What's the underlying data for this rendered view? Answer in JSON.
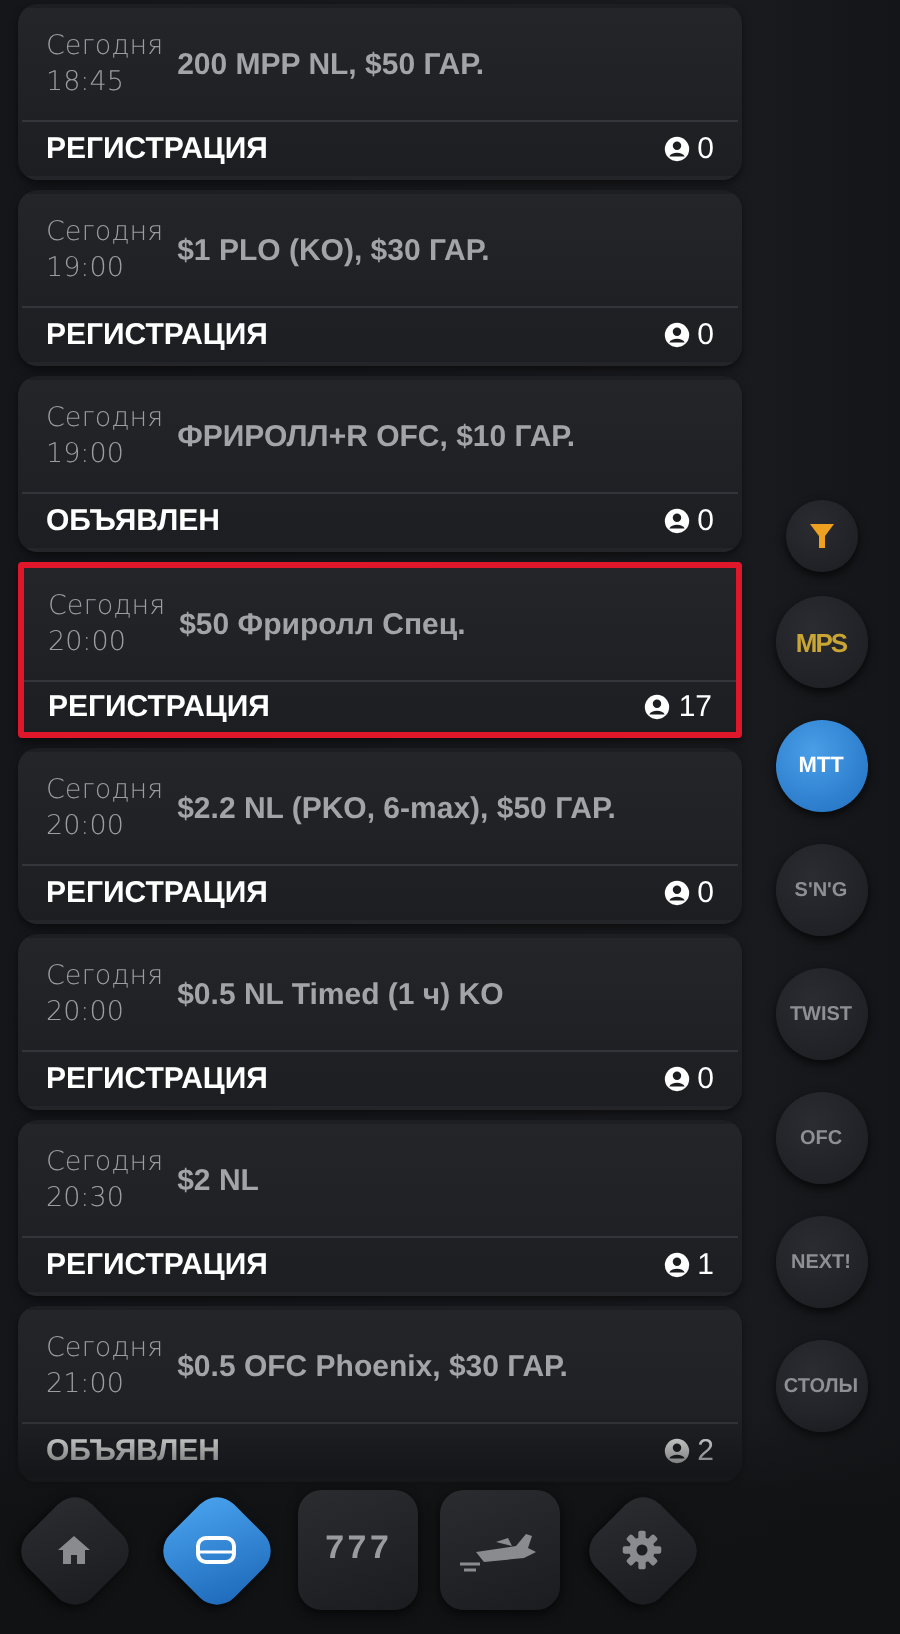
{
  "tournaments": [
    {
      "day": "Сегодня",
      "time": "18:45",
      "title": "200 MPP NL, $50 ГАР.",
      "status": "РЕГИСТРАЦИЯ",
      "players": "0",
      "highlighted": false
    },
    {
      "day": "Сегодня",
      "time": "19:00",
      "title": "$1 PLO (KO), $30 ГАР.",
      "status": "РЕГИСТРАЦИЯ",
      "players": "0",
      "highlighted": false
    },
    {
      "day": "Сегодня",
      "time": "19:00",
      "title": "ФРИРОЛЛ+R OFC, $10 ГАР.",
      "status": "ОБЪЯВЛЕН",
      "players": "0",
      "highlighted": false
    },
    {
      "day": "Сегодня",
      "time": "20:00",
      "title": "$50 Фриролл Спец.",
      "status": "РЕГИСТРАЦИЯ",
      "players": "17",
      "highlighted": true
    },
    {
      "day": "Сегодня",
      "time": "20:00",
      "title": "$2.2 NL (PKO, 6-max), $50 ГАР.",
      "status": "РЕГИСТРАЦИЯ",
      "players": "0",
      "highlighted": false
    },
    {
      "day": "Сегодня",
      "time": "20:00",
      "title": "$0.5 NL Timed (1 ч) KO",
      "status": "РЕГИСТРАЦИЯ",
      "players": "0",
      "highlighted": false
    },
    {
      "day": "Сегодня",
      "time": "20:30",
      "title": "$2 NL",
      "status": "РЕГИСТРАЦИЯ",
      "players": "1",
      "highlighted": false
    },
    {
      "day": "Сегодня",
      "time": "21:00",
      "title": "$0.5 OFC Phoenix, $30 ГАР.",
      "status": "ОБЪЯВЛЕН",
      "players": "2",
      "highlighted": false
    }
  ],
  "rail": [
    {
      "kind": "filter",
      "selected": false
    },
    {
      "kind": "logo",
      "label": "MPS",
      "selected": false
    },
    {
      "kind": "text",
      "label": "MTT",
      "selected": true
    },
    {
      "kind": "text",
      "label": "S'N'G",
      "selected": false
    },
    {
      "kind": "text",
      "label": "TWIST",
      "selected": false
    },
    {
      "kind": "text",
      "label": "OFC",
      "selected": false
    },
    {
      "kind": "text",
      "label": "NEXT!",
      "selected": false
    },
    {
      "kind": "text",
      "label": "СТОЛЫ",
      "selected": false
    }
  ],
  "nav": [
    {
      "kind": "home",
      "selected": false
    },
    {
      "kind": "tables",
      "selected": true
    },
    {
      "kind": "slots",
      "label": "777",
      "selected": false
    },
    {
      "kind": "crash",
      "selected": false
    },
    {
      "kind": "settings",
      "selected": false
    }
  ]
}
